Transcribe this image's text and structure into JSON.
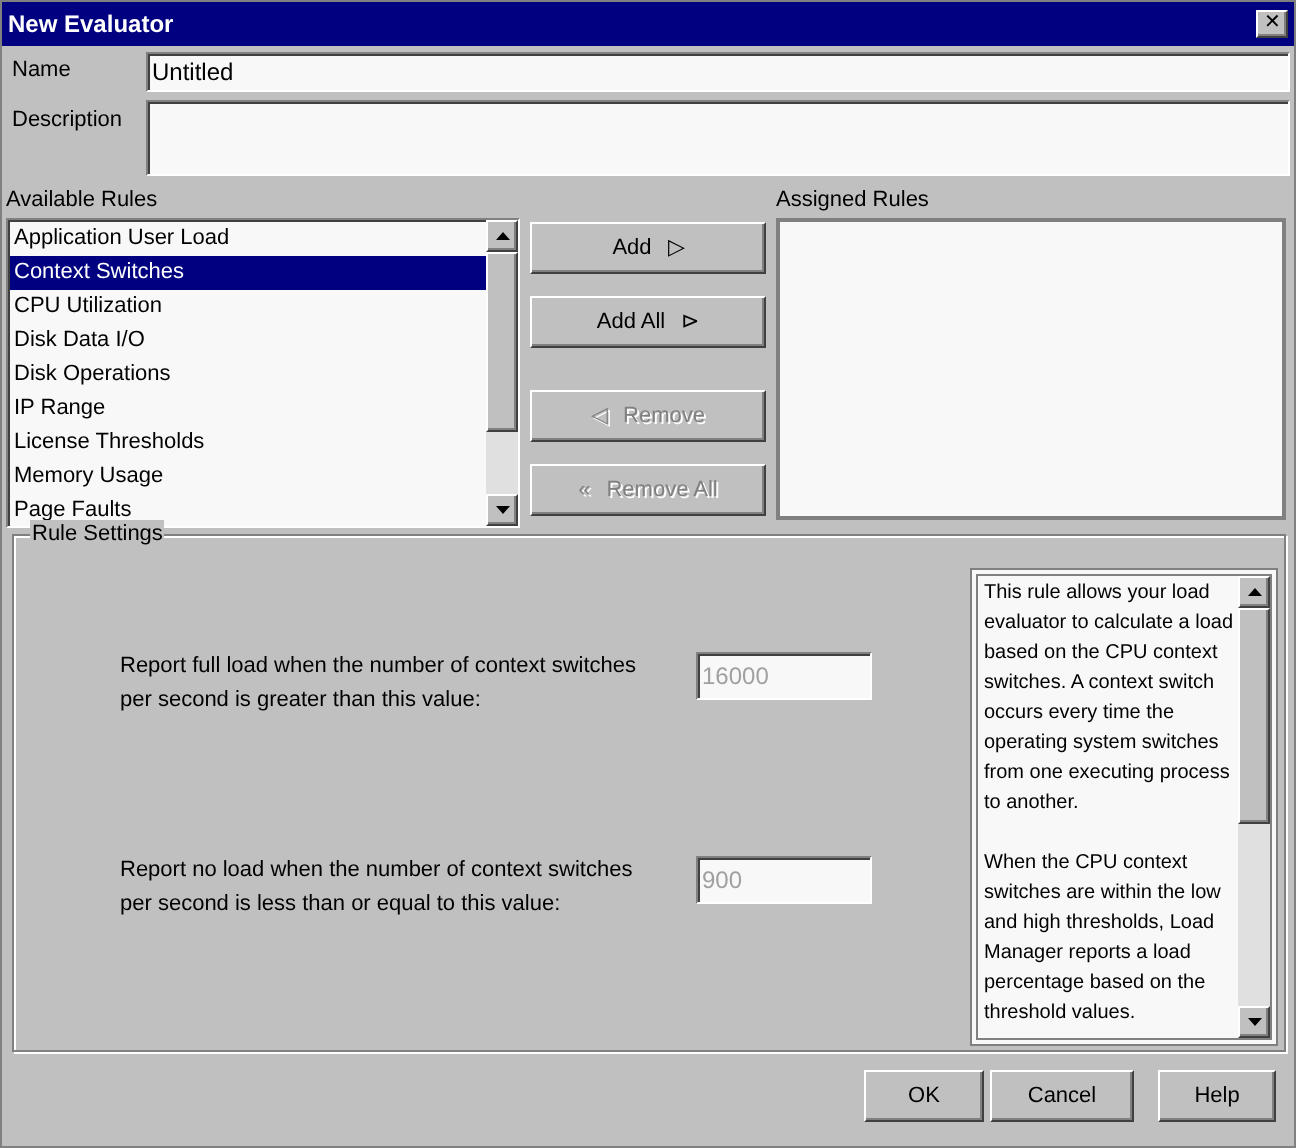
{
  "window": {
    "title": "New Evaluator",
    "close": "✕"
  },
  "name_field": {
    "label": "Name",
    "value": "Untitled"
  },
  "description_field": {
    "label": "Description"
  },
  "available_rules": {
    "label": "Available Rules",
    "items": [
      {
        "label": "Application User Load",
        "selected": false
      },
      {
        "label": "Context Switches",
        "selected": true
      },
      {
        "label": "CPU Utilization",
        "selected": false
      },
      {
        "label": "Disk Data I/O",
        "selected": false
      },
      {
        "label": "Disk Operations",
        "selected": false
      },
      {
        "label": "IP Range",
        "selected": false
      },
      {
        "label": "License Thresholds",
        "selected": false
      },
      {
        "label": "Memory Usage",
        "selected": false
      },
      {
        "label": "Page Faults",
        "selected": false
      }
    ]
  },
  "move_buttons": [
    {
      "label": "Add",
      "icon": "▷",
      "disabled": false
    },
    {
      "label": "Add All",
      "icon": "⊳",
      "disabled": false
    },
    {
      "label": "Remove",
      "icon": "◁",
      "disabled": true
    },
    {
      "label": "Remove All",
      "icon": "«",
      "disabled": true
    }
  ],
  "assigned_rules": {
    "label": "Assigned Rules"
  },
  "rule_settings": {
    "title": "Rule Settings",
    "fields": [
      {
        "label": "Report full load when the number of context switches per second is greater than this value:",
        "value": "16000",
        "disabled": true
      },
      {
        "label": "Report no load when the number of context switches per second is less than or equal to this value:",
        "value": "900",
        "disabled": true
      }
    ],
    "help_text": [
      "This rule allows your load evaluator to calculate a load based on the CPU context switches. A context switch occurs every time the operating system switches from one executing process to another.",
      "When the CPU context switches are within the low and high thresholds, Load Manager reports a load percentage based on the threshold values."
    ]
  },
  "buttons": [
    {
      "label": "OK"
    },
    {
      "label": "Cancel"
    },
    {
      "label": "Help"
    }
  ]
}
